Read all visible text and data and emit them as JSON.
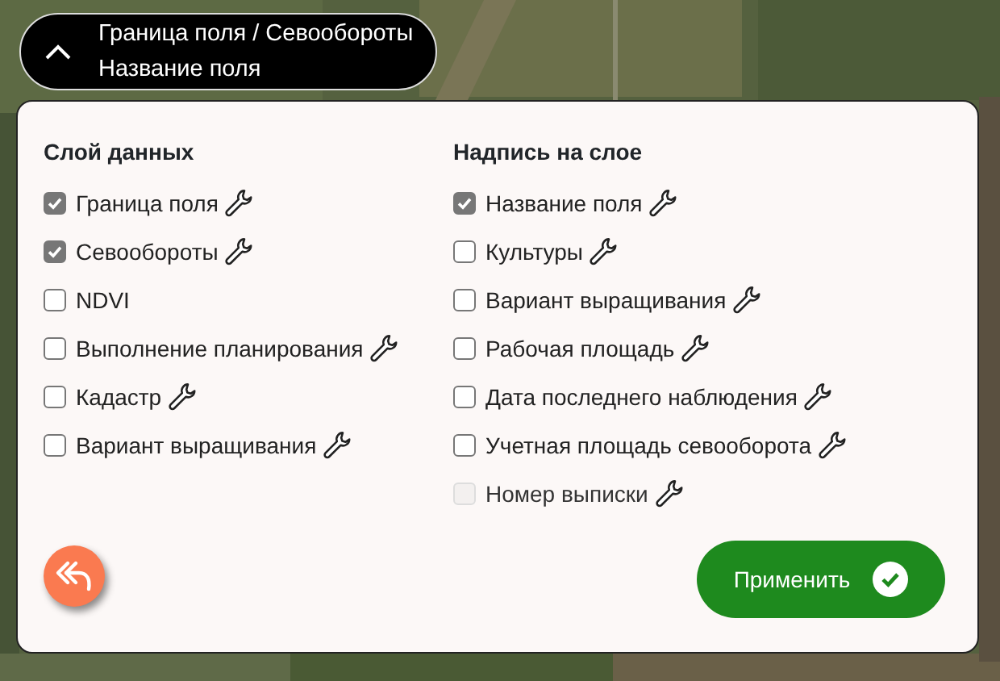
{
  "summary": {
    "expanded": true,
    "lines": [
      "Граница поля / Севообороты",
      "Название поля"
    ]
  },
  "columns": [
    {
      "title": "Слой данных",
      "items": [
        {
          "label": "Граница поля",
          "checked": true,
          "disabled": false,
          "settings": true
        },
        {
          "label": "Севообороты",
          "checked": true,
          "disabled": false,
          "settings": true
        },
        {
          "label": "NDVI",
          "checked": false,
          "disabled": false,
          "settings": false
        },
        {
          "label": "Выполнение планирования",
          "checked": false,
          "disabled": false,
          "settings": true
        },
        {
          "label": "Кадастр",
          "checked": false,
          "disabled": false,
          "settings": true
        },
        {
          "label": "Вариант выращивания",
          "checked": false,
          "disabled": false,
          "settings": true
        }
      ]
    },
    {
      "title": "Надпись на слое",
      "items": [
        {
          "label": "Название поля",
          "checked": true,
          "disabled": false,
          "settings": true
        },
        {
          "label": "Культуры",
          "checked": false,
          "disabled": false,
          "settings": true
        },
        {
          "label": "Вариант выращивания",
          "checked": false,
          "disabled": false,
          "settings": true
        },
        {
          "label": "Рабочая площадь",
          "checked": false,
          "disabled": false,
          "settings": true
        },
        {
          "label": "Дата последнего наблюдения",
          "checked": false,
          "disabled": false,
          "settings": true
        },
        {
          "label": "Учетная площадь севооборота",
          "checked": false,
          "disabled": false,
          "settings": true
        },
        {
          "label": "Номер выписки",
          "checked": false,
          "disabled": true,
          "settings": true
        }
      ]
    }
  ],
  "apply_button": {
    "label": "Применить"
  }
}
